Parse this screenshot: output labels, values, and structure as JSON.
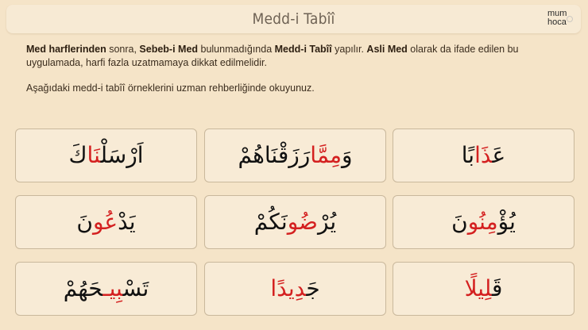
{
  "header": {
    "title": "Medd-i Tabîî",
    "logo_line1": "mum",
    "logo_line2": "hoca"
  },
  "intro": {
    "p1_part1": "Med harflerinden",
    "p1_part2": " sonra, ",
    "p1_part3": "Sebeb-i Med",
    "p1_part4": " bulunmadığında ",
    "p1_part5": "Medd-i Tabîî",
    "p1_part6": " yapılır. ",
    "p1_part7": "Asli Med",
    "p1_part8": " olarak da ifade edilen bu uygulamada, harfi fazla uzatmamaya dikkat edilmelidir.",
    "p2": "Aşağıdaki medd-i tabîî örneklerini uzman rehberliğinde okuyunuz."
  },
  "cards": [
    {
      "before": "عَ",
      "highlight": "ذَا",
      "after": "بًا"
    },
    {
      "before": "وَ",
      "highlight": "مِمَّا",
      "after": "رَزَقْنَاهُمْ"
    },
    {
      "before": "اَرْسَلْ",
      "highlight": "نَا",
      "after": "كَ"
    },
    {
      "before": "يُؤْ",
      "highlight": "مِنُو",
      "after": "نَ"
    },
    {
      "before": "يُرْ",
      "highlight": "ضُو",
      "after": "نَكُمْ"
    },
    {
      "before": "يَدْ",
      "highlight": "عُو",
      "after": "نَ"
    },
    {
      "before": "قَ",
      "highlight": "لِيلًا",
      "after": ""
    },
    {
      "before": "جَ",
      "highlight": "دِيدًا",
      "after": ""
    },
    {
      "before": "تَسْ",
      "highlight": "بِيـ",
      "after": "حَهُمْ"
    }
  ],
  "colors": {
    "background": "#f5e4c8",
    "card_background": "#f8ebd6",
    "card_border": "#c9b89c",
    "highlight": "#d42020"
  }
}
